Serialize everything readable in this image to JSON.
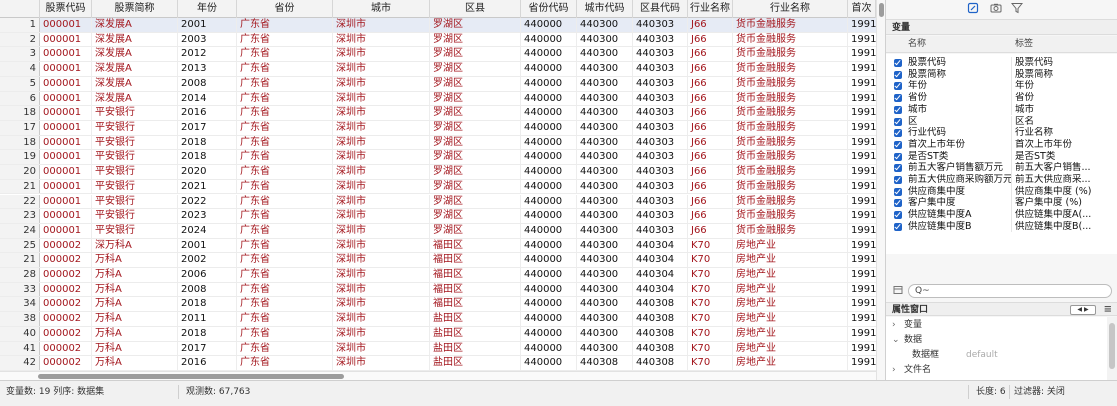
{
  "grid": {
    "columns": [
      "",
      "股票代码",
      "股票简称",
      "年份",
      "省份",
      "城市",
      "区县",
      "省份代码",
      "城市代码",
      "区县代码",
      "行业名称",
      "行业名称",
      "首次"
    ],
    "rows": [
      [
        "1",
        "000001",
        "深发展A",
        "2001",
        "广东省",
        "深圳市",
        "罗湖区",
        "440000",
        "440300",
        "440303",
        "J66",
        "货币金融服务",
        "1991"
      ],
      [
        "2",
        "000001",
        "深发展A",
        "2003",
        "广东省",
        "深圳市",
        "罗湖区",
        "440000",
        "440300",
        "440303",
        "J66",
        "货币金融服务",
        "1991"
      ],
      [
        "3",
        "000001",
        "深发展A",
        "2012",
        "广东省",
        "深圳市",
        "罗湖区",
        "440000",
        "440300",
        "440303",
        "J66",
        "货币金融服务",
        "1991"
      ],
      [
        "4",
        "000001",
        "深发展A",
        "2013",
        "广东省",
        "深圳市",
        "罗湖区",
        "440000",
        "440300",
        "440303",
        "J66",
        "货币金融服务",
        "1991"
      ],
      [
        "5",
        "000001",
        "深发展A",
        "2008",
        "广东省",
        "深圳市",
        "罗湖区",
        "440000",
        "440300",
        "440303",
        "J66",
        "货币金融服务",
        "1991"
      ],
      [
        "6",
        "000001",
        "深发展A",
        "2014",
        "广东省",
        "深圳市",
        "罗湖区",
        "440000",
        "440300",
        "440303",
        "J66",
        "货币金融服务",
        "1991"
      ],
      [
        "18",
        "000001",
        "平安银行",
        "2016",
        "广东省",
        "深圳市",
        "罗湖区",
        "440000",
        "440300",
        "440303",
        "J66",
        "货币金融服务",
        "1991"
      ],
      [
        "17",
        "000001",
        "平安银行",
        "2017",
        "广东省",
        "深圳市",
        "罗湖区",
        "440000",
        "440300",
        "440303",
        "J66",
        "货币金融服务",
        "1991"
      ],
      [
        "18",
        "000001",
        "平安银行",
        "2018",
        "广东省",
        "深圳市",
        "罗湖区",
        "440000",
        "440300",
        "440303",
        "J66",
        "货币金融服务",
        "1991"
      ],
      [
        "19",
        "000001",
        "平安银行",
        "2018",
        "广东省",
        "深圳市",
        "罗湖区",
        "440000",
        "440300",
        "440303",
        "J66",
        "货币金融服务",
        "1991"
      ],
      [
        "20",
        "000001",
        "平安银行",
        "2020",
        "广东省",
        "深圳市",
        "罗湖区",
        "440000",
        "440300",
        "440303",
        "J66",
        "货币金融服务",
        "1991"
      ],
      [
        "21",
        "000001",
        "平安银行",
        "2021",
        "广东省",
        "深圳市",
        "罗湖区",
        "440000",
        "440300",
        "440303",
        "J66",
        "货币金融服务",
        "1991"
      ],
      [
        "22",
        "000001",
        "平安银行",
        "2022",
        "广东省",
        "深圳市",
        "罗湖区",
        "440000",
        "440300",
        "440303",
        "J66",
        "货币金融服务",
        "1991"
      ],
      [
        "23",
        "000001",
        "平安银行",
        "2023",
        "广东省",
        "深圳市",
        "罗湖区",
        "440000",
        "440300",
        "440303",
        "J66",
        "货币金融服务",
        "1991"
      ],
      [
        "24",
        "000001",
        "平安银行",
        "2024",
        "广东省",
        "深圳市",
        "罗湖区",
        "440000",
        "440300",
        "440303",
        "J66",
        "货币金融服务",
        "1991"
      ],
      [
        "25",
        "000002",
        "深万科A",
        "2001",
        "广东省",
        "深圳市",
        "福田区",
        "440000",
        "440300",
        "440304",
        "K70",
        "房地产业",
        "1991"
      ],
      [
        "21",
        "000002",
        "万科A",
        "2002",
        "广东省",
        "深圳市",
        "福田区",
        "440000",
        "440300",
        "440304",
        "K70",
        "房地产业",
        "1991"
      ],
      [
        "28",
        "000002",
        "万科A",
        "2006",
        "广东省",
        "深圳市",
        "福田区",
        "440000",
        "440300",
        "440304",
        "K70",
        "房地产业",
        "1991"
      ],
      [
        "33",
        "000002",
        "万科A",
        "2008",
        "广东省",
        "深圳市",
        "福田区",
        "440000",
        "440300",
        "440304",
        "K70",
        "房地产业",
        "1991"
      ],
      [
        "34",
        "000002",
        "万科A",
        "2018",
        "广东省",
        "深圳市",
        "福田区",
        "440000",
        "440300",
        "440308",
        "K70",
        "房地产业",
        "1991"
      ],
      [
        "38",
        "000002",
        "万科A",
        "2011",
        "广东省",
        "深圳市",
        "盐田区",
        "440000",
        "440300",
        "440308",
        "K70",
        "房地产业",
        "1991"
      ],
      [
        "40",
        "000002",
        "万科A",
        "2018",
        "广东省",
        "深圳市",
        "盐田区",
        "440000",
        "440300",
        "440308",
        "K70",
        "房地产业",
        "1991"
      ],
      [
        "41",
        "000002",
        "万科A",
        "2017",
        "广东省",
        "深圳市",
        "盐田区",
        "440000",
        "440300",
        "440308",
        "K70",
        "房地产业",
        "1991"
      ],
      [
        "42",
        "000002",
        "万科A",
        "2016",
        "广东省",
        "深圳市",
        "盐田区",
        "440000",
        "440308",
        "440308",
        "K70",
        "房地产业",
        "1991"
      ]
    ],
    "selected_row_index": 0
  },
  "toolbar": {
    "icons": [
      "pencil-icon",
      "camera-icon",
      "filter-icon"
    ]
  },
  "variables": {
    "title": "变量",
    "col_name": "名称",
    "col_label": "标签",
    "items": [
      {
        "name": "股票代码",
        "label": "股票代码"
      },
      {
        "name": "股票简称",
        "label": "股票简称"
      },
      {
        "name": "年份",
        "label": "年份"
      },
      {
        "name": "省份",
        "label": "省份"
      },
      {
        "name": "城市",
        "label": "城市"
      },
      {
        "name": "区",
        "label": "区名"
      },
      {
        "name": "行业代码",
        "label": "行业名称"
      },
      {
        "name": "首次上市年份",
        "label": "首次上市年份"
      },
      {
        "name": "是否ST类",
        "label": "是否ST类"
      },
      {
        "name": "前五大客户销售额万元",
        "label": "前五大客户销售..."
      },
      {
        "name": "前五大供应商采购额万元",
        "label": "前五大供应商采..."
      },
      {
        "name": "供应商集中度",
        "label": "供应商集中度 (%)"
      },
      {
        "name": "客户集中度",
        "label": "客户集中度 (%)"
      },
      {
        "name": "供应链集中度A",
        "label": "供应链集中度A(..."
      },
      {
        "name": "供应链集中度B",
        "label": "供应链集中度B(..."
      }
    ]
  },
  "filter": {
    "placeholder": "Q~"
  },
  "properties": {
    "title": "属性窗口",
    "nav": "◀ ▶",
    "rows": [
      {
        "arrow": "›",
        "label": "变量",
        "value": ""
      },
      {
        "arrow": "⌄",
        "label": "数据",
        "value": ""
      },
      {
        "arrow": "",
        "label": "数据框",
        "value": "default"
      },
      {
        "arrow": "›",
        "label": "文件名",
        "value": ""
      }
    ]
  },
  "status": {
    "vars": "变量数: 19 列序: 数据集",
    "obs": "观测数: 67,763",
    "len": "长度: 6",
    "mode": "过滤器: 关闭"
  }
}
